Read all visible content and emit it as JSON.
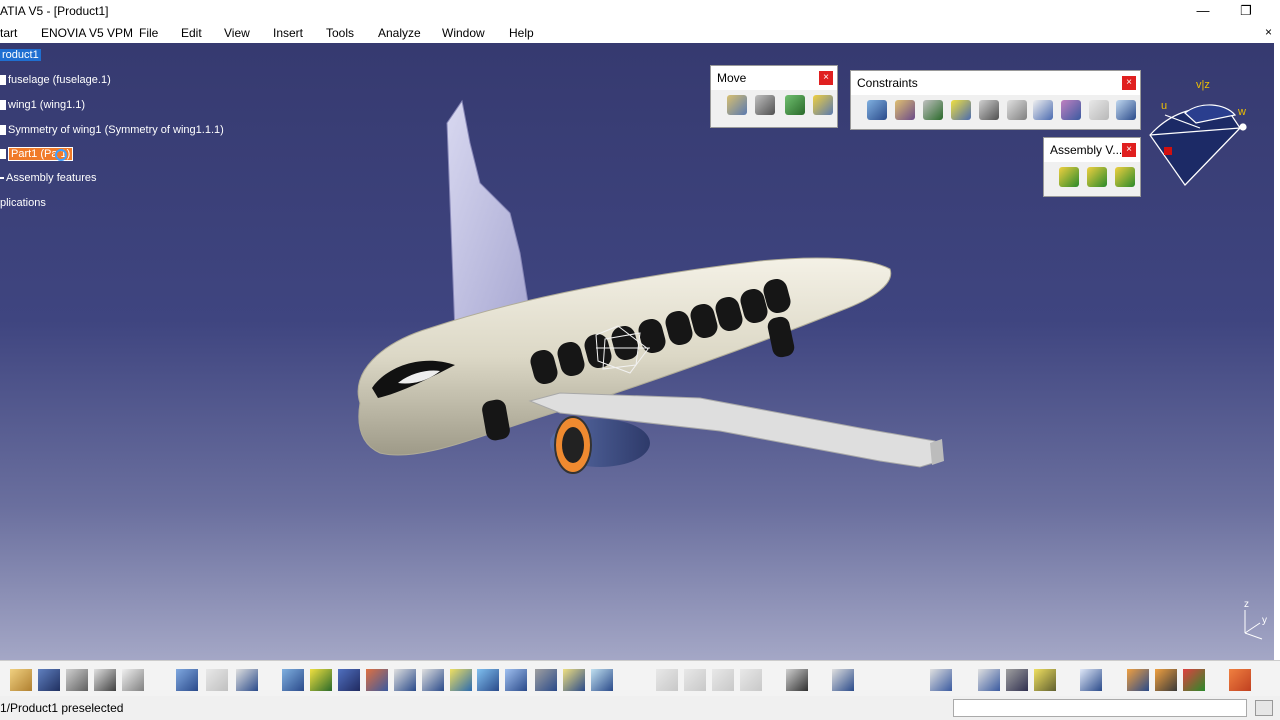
{
  "window": {
    "title": "ATIA V5 - [Product1]",
    "minimize": "—",
    "restore": "❐"
  },
  "menu": {
    "items": [
      "tart",
      "ENOVIA V5 VPM",
      "File",
      "Edit",
      "View",
      "Insert",
      "Tools",
      "Analyze",
      "Window",
      "Help"
    ],
    "close": "×"
  },
  "tree": {
    "root": "roduct1",
    "fuselage": "fuselage (fuselage.1)",
    "wing": "wing1 (wing1.1)",
    "symmetry": "Symmetry of wing1 (Symmetry of wing1.1.1)",
    "part": "Part1 (Pa  1)",
    "assembly_features": "Assembly features",
    "applications": "plications"
  },
  "toolbars": {
    "move": {
      "title": "Move",
      "close": "×"
    },
    "constraints": {
      "title": "Constraints",
      "close": "×"
    },
    "assembly": {
      "title": "Assembly V...",
      "close": "×"
    }
  },
  "compass": {
    "v_z": "v|z",
    "u": "u",
    "w": "w"
  },
  "axis": {
    "z": "z",
    "y": "y"
  },
  "status": {
    "text": "1/Product1 preselected",
    "input_value": ""
  },
  "colors": {
    "viewport_top": "#363a70",
    "viewport_bottom": "#a4a7c6",
    "tree_selected": "#1f6fd1",
    "part_highlight": "#f07a28",
    "close_red": "#e02020",
    "compass_label": "#f0c000"
  }
}
